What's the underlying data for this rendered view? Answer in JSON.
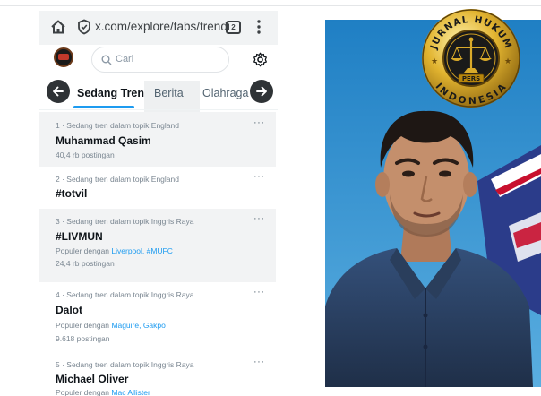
{
  "browser": {
    "url": "x.com/explore/tabs/trendi",
    "tab_count": "2"
  },
  "search": {
    "placeholder": "Cari"
  },
  "tabs": [
    {
      "label": "Sedang Tren",
      "active": true
    },
    {
      "label": "Berita",
      "active": false
    },
    {
      "label": "Olahraga",
      "active": false
    }
  ],
  "trends": [
    {
      "context": "1 · Sedang tren dalam topik England",
      "name": "Muhammad Qasim",
      "popular_prefix": "",
      "popular_links": "",
      "posts": "40,4 rb postingan",
      "more": "···"
    },
    {
      "context": "2 · Sedang tren dalam topik England",
      "name": "#totvil",
      "popular_prefix": "",
      "popular_links": "",
      "posts": "",
      "more": "···"
    },
    {
      "context": "3 · Sedang tren dalam topik Inggris Raya",
      "name": "#LIVMUN",
      "popular_prefix": "Populer dengan ",
      "popular_links": "Liverpool, #MUFC",
      "posts": "24,4 rb postingan",
      "more": "···"
    },
    {
      "context": "4 · Sedang tren dalam topik Inggris Raya",
      "name": "Dalot",
      "popular_prefix": "Populer dengan ",
      "popular_links": "Maguire, Gakpo",
      "posts": "9.618 postingan",
      "more": "···"
    },
    {
      "context": "5 · Sedang tren dalam topik Inggris Raya",
      "name": "Michael Oliver",
      "popular_prefix": "Populer dengan ",
      "popular_links": "Mac Allister",
      "posts": "",
      "more": "···"
    }
  ],
  "badge": {
    "top_text": "JURNAL HUKUM",
    "bottom_text": "INDONESIA",
    "center_text": "PERS"
  },
  "colors": {
    "accent": "#1d9bf0",
    "badge_gold": "#d4a017",
    "photo_sky": "#2b8fd0",
    "shirt": "#2a3e5c"
  }
}
